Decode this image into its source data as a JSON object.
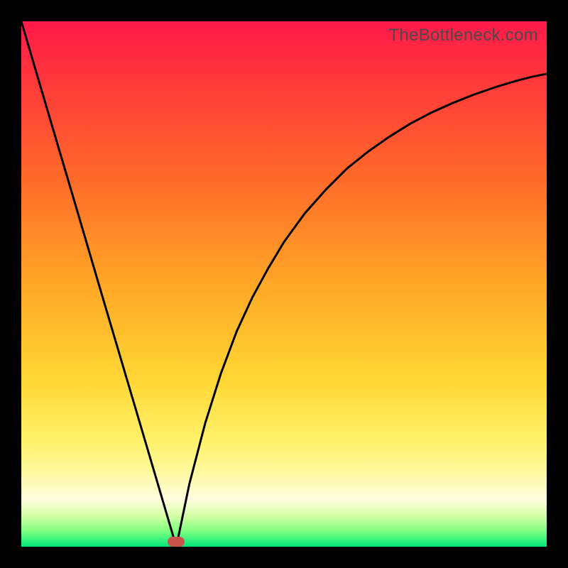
{
  "attribution": "TheBottleneck.com",
  "chart_data": {
    "type": "line",
    "title": "",
    "xlabel": "",
    "ylabel": "",
    "xlim": [
      0,
      1
    ],
    "ylim": [
      0,
      1
    ],
    "series": [
      {
        "name": "left-branch",
        "x": [
          0.0,
          0.05,
          0.1,
          0.15,
          0.2,
          0.25,
          0.295
        ],
        "y": [
          1.0,
          0.83,
          0.661,
          0.491,
          0.322,
          0.153,
          0.0
        ]
      },
      {
        "name": "right-branch",
        "x": [
          0.295,
          0.32,
          0.35,
          0.38,
          0.41,
          0.44,
          0.47,
          0.5,
          0.54,
          0.58,
          0.62,
          0.66,
          0.7,
          0.74,
          0.78,
          0.82,
          0.86,
          0.9,
          0.94,
          0.97,
          1.0
        ],
        "y": [
          0.0,
          0.12,
          0.235,
          0.33,
          0.41,
          0.475,
          0.53,
          0.58,
          0.635,
          0.68,
          0.72,
          0.752,
          0.78,
          0.805,
          0.826,
          0.844,
          0.86,
          0.874,
          0.886,
          0.894,
          0.9
        ]
      }
    ],
    "marker": {
      "x": 0.295,
      "y": 0.01
    },
    "background_gradient": {
      "top": "#ff1a4a",
      "mid1": "#ffa726",
      "mid2": "#fff26b",
      "bottom": "#00e67a"
    }
  }
}
